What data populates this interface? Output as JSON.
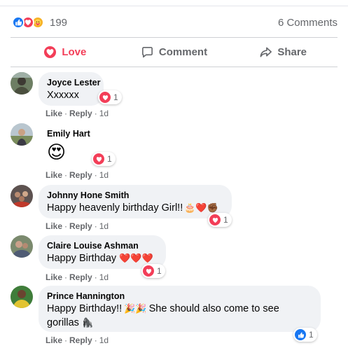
{
  "summary": {
    "reaction_icons": [
      "like-icon",
      "love-icon",
      "care-icon"
    ],
    "reaction_count": "199",
    "comments_count": "6 Comments"
  },
  "actions": {
    "love_label": "Love",
    "comment_label": "Comment",
    "share_label": "Share"
  },
  "meta_labels": {
    "like": "Like",
    "reply": "Reply",
    "separator": "·"
  },
  "comments": [
    {
      "author": "Joyce Lester",
      "text": "Xxxxxx",
      "reaction": "love-icon",
      "reaction_count": "1",
      "time": "1d"
    },
    {
      "author": "Emily Hart",
      "text": "😍",
      "reaction": "love-icon",
      "reaction_count": "1",
      "time": "1d"
    },
    {
      "author": "Johnny Hone Smith",
      "text": "Happy heavenly birthday Girl!!",
      "trailing_emoji": "🎂❤️✊🏾",
      "reaction": "love-icon",
      "reaction_count": "1",
      "time": "1d"
    },
    {
      "author": "Claire Louise Ashman",
      "text": "Happy Birthday",
      "trailing_emoji": "❤️❤️❤️",
      "reaction": "love-icon",
      "reaction_count": "1",
      "time": "1d"
    },
    {
      "author": "Prince Hannington",
      "text_line1": "Happy Birthday!!",
      "emoji_line1": "🎉🎉",
      "text_line1b": "She should also come to see",
      "text_line2": "gorillas",
      "emoji_line2": "🦍",
      "reaction": "like-icon",
      "reaction_count": "1",
      "time": "1d"
    }
  ],
  "colors": {
    "love": "#f33e58",
    "like": "#1877f2",
    "muted": "#65676b",
    "bubble": "#f0f2f5"
  }
}
